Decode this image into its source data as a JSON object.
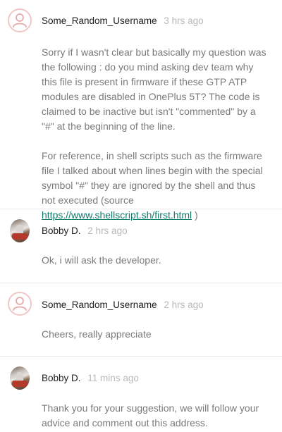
{
  "comments": [
    {
      "username": "Some_Random_Username",
      "time": "3 hrs ago",
      "avatar": "default-user-icon",
      "paragraphs": [
        "Sorry if I wasn't clear but basically my question was the following : do you mind asking dev team why this file is present in firmware if these GTP ATP modules are disabled in OnePlus 5T? The code is claimed to be inactive but isn't \"commented\" by a \"#\" at the beginning of the line."
      ],
      "p2_prefix": "For reference, in shell scripts such as the firmware file I talked about when lines begin with the special symbol \"#\" they are ignored by the shell and thus not executed (source ",
      "p2_link": "https://www.shellscript.sh/first.html",
      "p2_suffix": " )"
    },
    {
      "username": "Bobby D.",
      "time": "2 hrs ago",
      "avatar": "profile-photo",
      "paragraphs": [
        "Ok, i will ask the developer."
      ]
    },
    {
      "username": "Some_Random_Username",
      "time": "2 hrs ago",
      "avatar": "default-user-icon",
      "paragraphs": [
        "Cheers, really appreciate"
      ]
    },
    {
      "username": "Bobby D.",
      "time": "11 mins ago",
      "avatar": "profile-photo",
      "paragraphs": [
        "Thank you for your suggestion, we will follow your advice and comment out this address."
      ]
    }
  ]
}
